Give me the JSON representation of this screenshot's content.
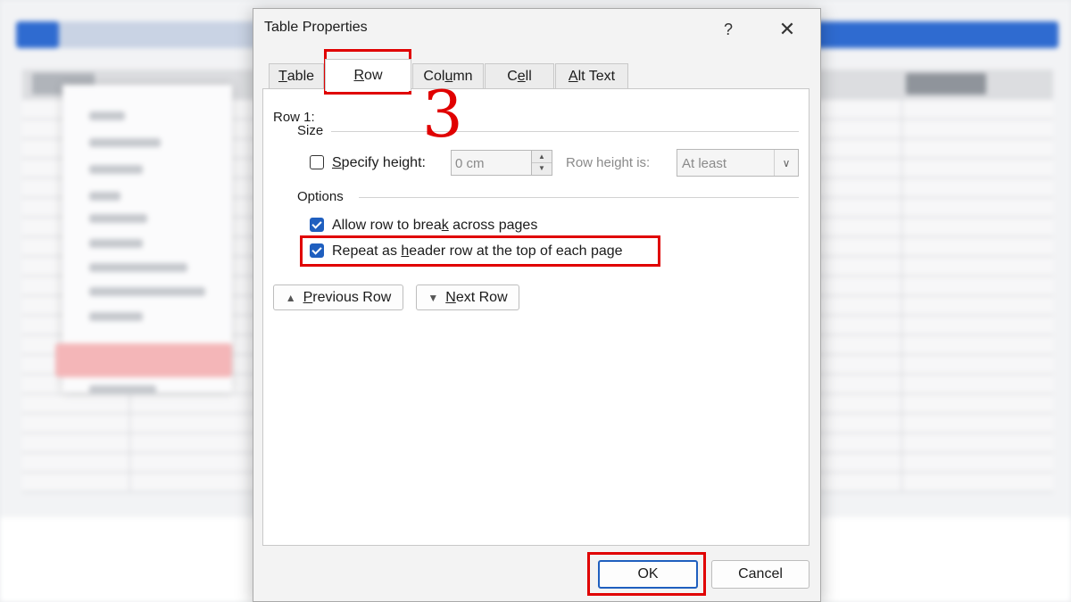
{
  "dialog": {
    "title": "Table Properties",
    "help_label": "?",
    "close_label": "✕",
    "tabs": [
      {
        "pre": "",
        "mn": "T",
        "post": "able"
      },
      {
        "pre": "",
        "mn": "R",
        "post": "ow"
      },
      {
        "pre": "Col",
        "mn": "u",
        "post": "mn"
      },
      {
        "pre": "C",
        "mn": "e",
        "post": "ll"
      },
      {
        "pre": "",
        "mn": "A",
        "post": "lt Text"
      }
    ],
    "active_tab": "Row",
    "row_label": "Row 1:",
    "size": {
      "section_label": "Size",
      "specify_height": {
        "pre": "",
        "mn": "S",
        "post": "pecify height:",
        "checked": false
      },
      "height_value": "0 cm",
      "row_height_label": "Row height is:",
      "row_height_mode": "At least"
    },
    "options": {
      "section_label": "Options",
      "allow_break": {
        "pre": "Allow row to brea",
        "mn": "k",
        "post": " across pages",
        "checked": true
      },
      "repeat_header": {
        "pre": "Repeat as ",
        "mn": "h",
        "post": "eader row at the top of each page",
        "checked": true
      }
    },
    "prev_row": {
      "pre": "",
      "mn": "P",
      "post": "revious Row"
    },
    "next_row": {
      "pre": "",
      "mn": "N",
      "post": "ext Row"
    },
    "ok_label": "OK",
    "cancel_label": "Cancel"
  },
  "annotation": {
    "step_number": "3",
    "color": "#e00000"
  },
  "colors": {
    "accent": "#1f5fbf"
  },
  "icons": {
    "spin_up": "▲",
    "spin_down": "▼",
    "dropdown": "∨",
    "prev": "▲",
    "next": "▼"
  }
}
